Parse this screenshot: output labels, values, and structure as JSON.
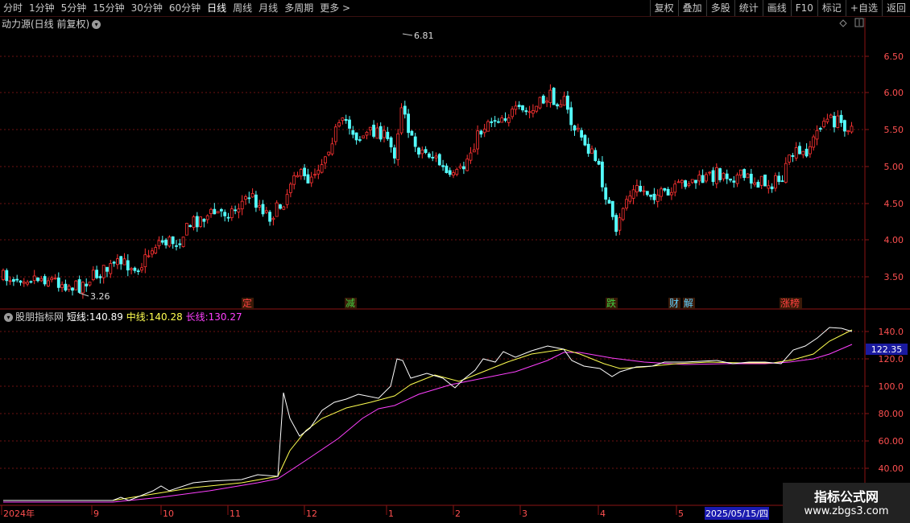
{
  "toolbar": {
    "periods": [
      "分时",
      "1分钟",
      "5分钟",
      "15分钟",
      "30分钟",
      "60分钟",
      "日线",
      "周线",
      "月线",
      "多周期",
      "更多 >"
    ],
    "active_period": "日线",
    "right_buttons": [
      "复权",
      "叠加",
      "多股",
      "统计",
      "画线",
      "F10",
      "标记",
      "+自选",
      "返回"
    ]
  },
  "price_pane": {
    "title": "动力源(日线 前复权)",
    "y_axis": [
      "6.50",
      "6.00",
      "5.50",
      "5.00",
      "4.50",
      "4.00",
      "3.50"
    ],
    "high_label": "6.81",
    "low_label": "3.26",
    "events": [
      {
        "text": "定",
        "color": "#ff4040"
      },
      {
        "text": "减",
        "color": "#40d040"
      },
      {
        "text": "跌",
        "color": "#40d040"
      },
      {
        "text": "财",
        "color": "#5fd0ff"
      },
      {
        "text": "解",
        "color": "#5fd0ff"
      },
      {
        "text": "涨榜",
        "color": "#ff4040"
      }
    ]
  },
  "indicator_pane": {
    "name": "股朋指标网",
    "short_label": "短线:",
    "short_value": "140.89",
    "mid_label": "中线:",
    "mid_value": "140.28",
    "long_label": "长线:",
    "long_value": "130.27",
    "y_axis": [
      "140.0",
      "120.0",
      "100.0",
      "80.00",
      "60.00",
      "40.00"
    ],
    "current_value": "122.35"
  },
  "x_axis": {
    "labels": [
      "2024年",
      "9",
      "10",
      "11",
      "12",
      "1",
      "2",
      "3",
      "4",
      "5"
    ],
    "cursor_date": "2025/05/15/四"
  },
  "watermark": {
    "line1": "指标公式网",
    "line2": "www.zbgs3.com"
  },
  "colors": {
    "up": "#ff3232",
    "down": "#54ffff",
    "short": "#ffffff",
    "mid": "#ffff50",
    "long": "#ff40ff",
    "grid": "#6e1212",
    "axis": "#8b1515"
  }
}
